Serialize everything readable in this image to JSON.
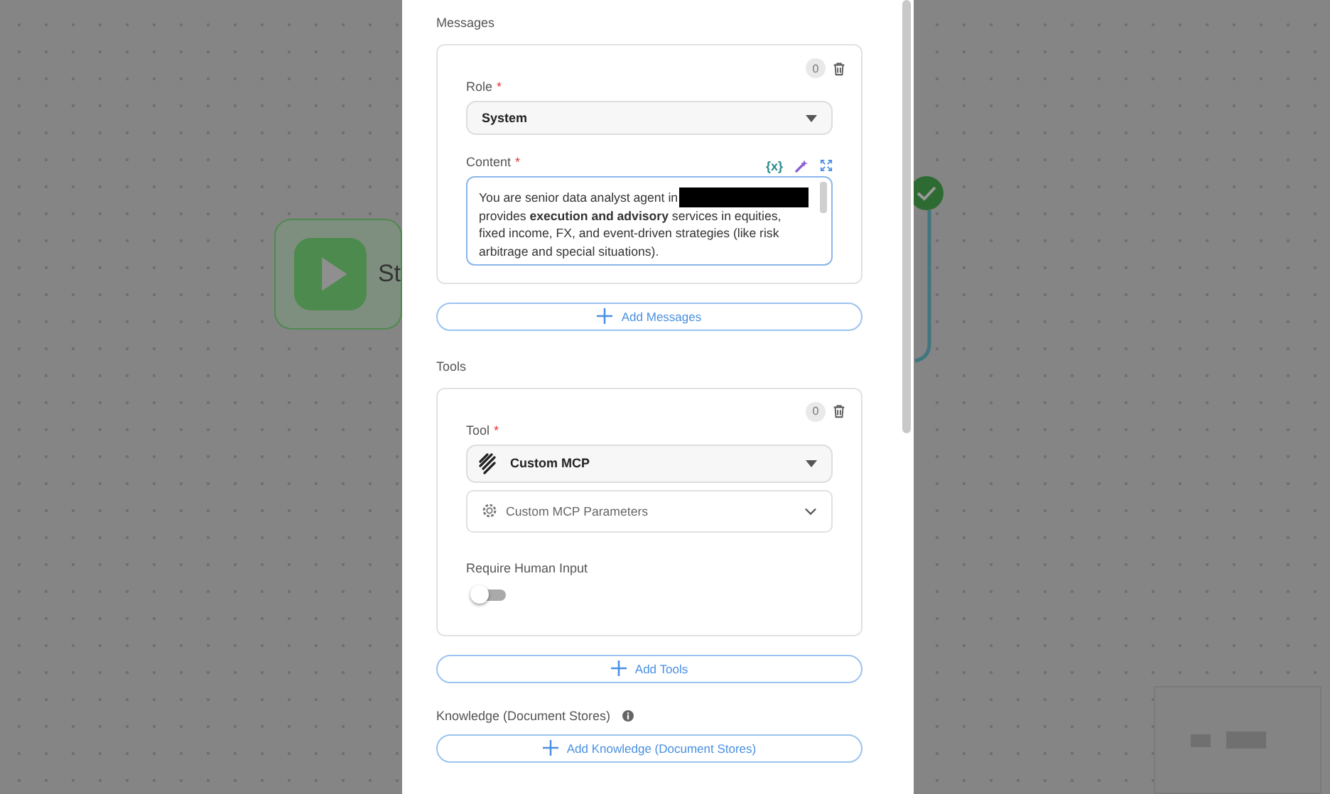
{
  "canvas": {
    "start_node": {
      "label": "St"
    },
    "status_node": {
      "done": true
    }
  },
  "panel": {
    "messages": {
      "heading": "Messages",
      "items": [
        {
          "count": "0",
          "role": {
            "label": "Role",
            "required_mark": "*",
            "value": "System"
          },
          "content": {
            "label": "Content",
            "required_mark": "*",
            "variable_button": "{x}",
            "first_line": "You are senior data analyst agent in",
            "redacted": true,
            "rest": "provides **execution and advisory** services in equities, fixed income, FX, and event-driven strategies (like risk arbitrage and special situations)."
          }
        }
      ],
      "add_button": "Add Messages"
    },
    "tools": {
      "heading": "Tools",
      "items": [
        {
          "count": "0",
          "tool": {
            "label": "Tool",
            "required_mark": "*",
            "value": "Custom MCP"
          },
          "parameters": "Custom MCP Parameters",
          "require_human_input": {
            "label": "Require Human Input",
            "on": false
          }
        }
      ],
      "add_button": "Add Tools"
    },
    "knowledge": {
      "heading": "Knowledge (Document Stores)",
      "add_button": "Add Knowledge (Document Stores)"
    }
  }
}
